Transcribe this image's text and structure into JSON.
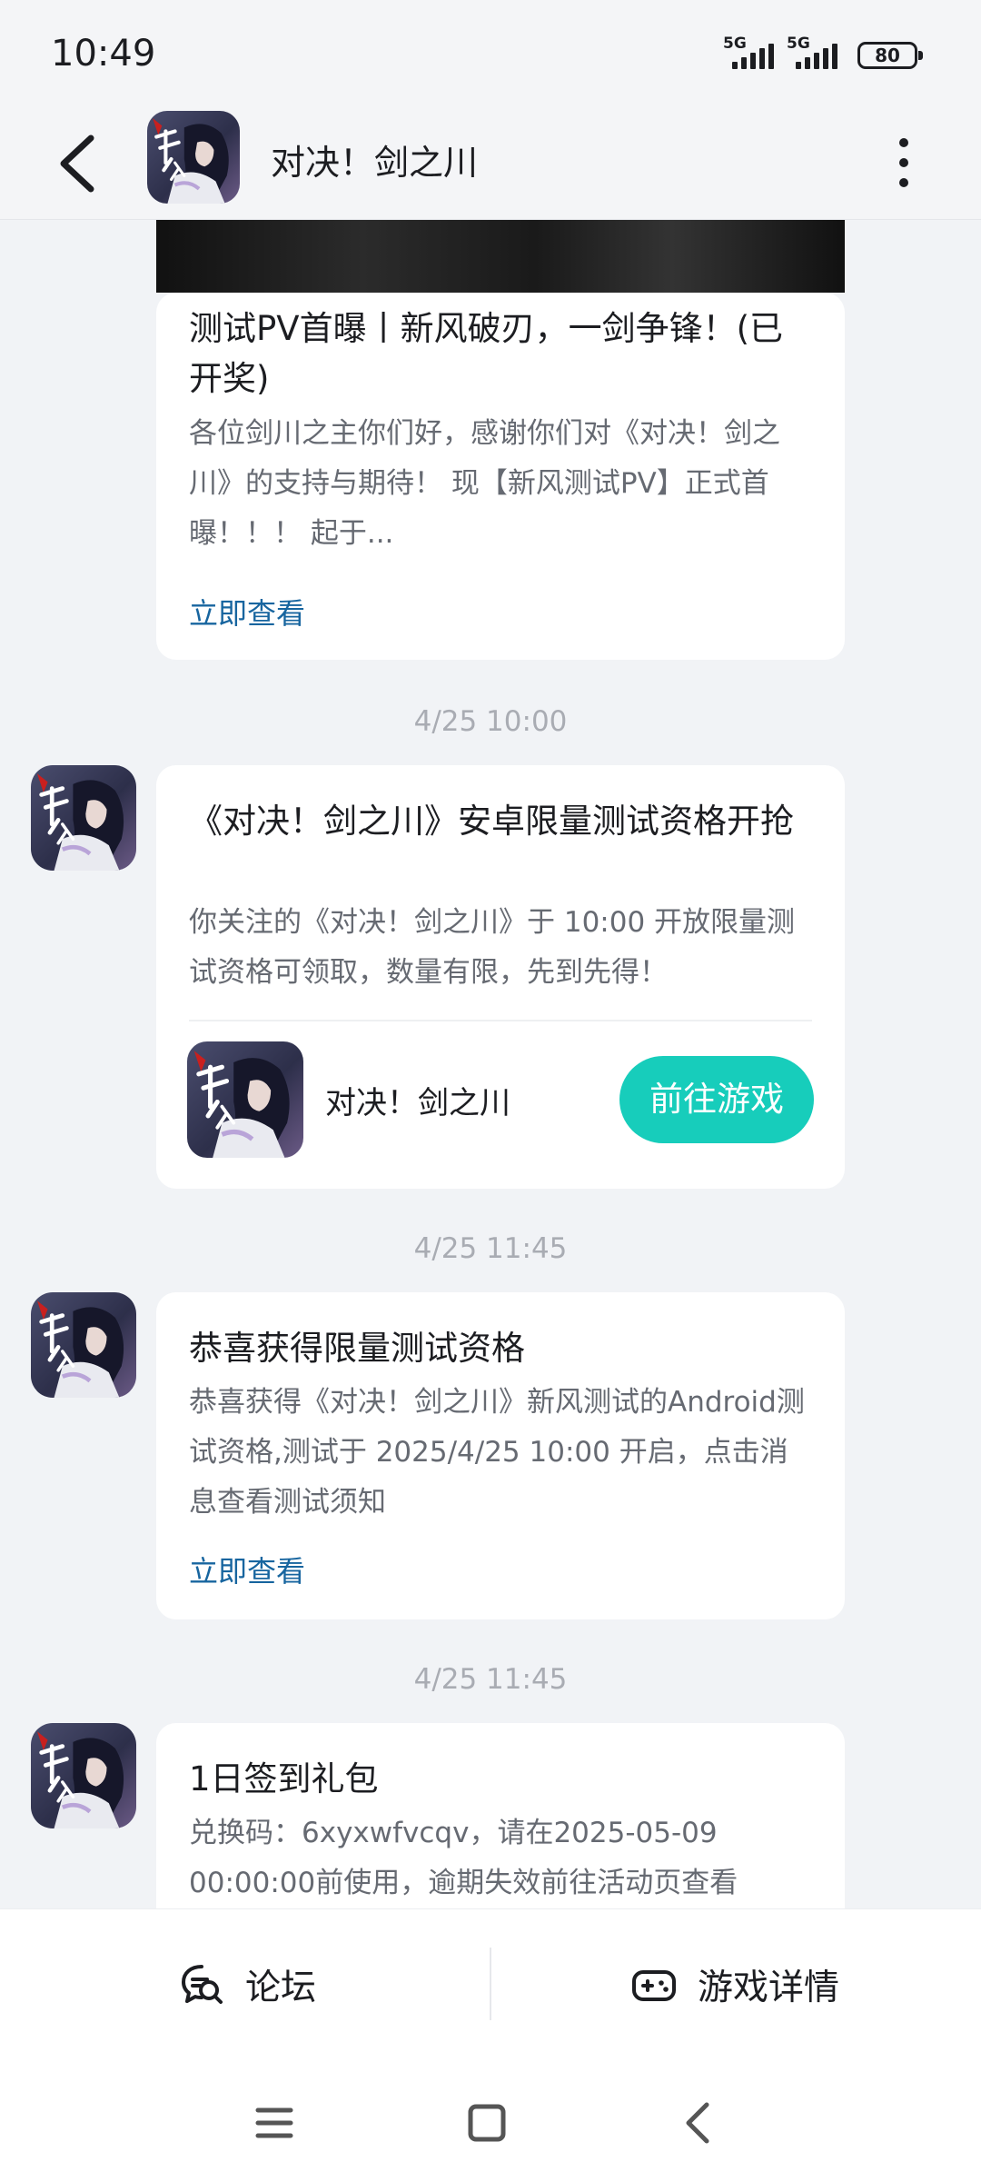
{
  "status_bar": {
    "time": "10:49",
    "signal_1": "5G",
    "signal_2": "5G",
    "battery": "80"
  },
  "header": {
    "title": "对决！剑之川",
    "avatar_icon": "game-logo-icon"
  },
  "messages": [
    {
      "title": "测试PV首曝丨新风破刃，一剑争锋！(已开奖)",
      "body": "各位剑川之主你们好，感谢你们对《对决！剑之川》的支持与期待！ 现【新风测试PV】正式首曝！！！ 起于...",
      "link": "立即查看"
    },
    {
      "timestamp": "4/25  10:00",
      "title": "《对决！剑之川》安卓限量测试资格开抢",
      "body": "你关注的《对决！剑之川》于 10:00 开放限量测试资格可领取，数量有限，先到先得！",
      "game_name": "对决！剑之川",
      "button": "前往游戏"
    },
    {
      "timestamp": "4/25  11:45",
      "title": "恭喜获得限量测试资格",
      "body": "恭喜获得《对决！剑之川》新风测试的Android测试资格,测试于 2025/4/25 10:00 开启，点击消息查看测试须知",
      "link": "立即查看"
    },
    {
      "timestamp": "4/25  11:45",
      "title": "1日签到礼包",
      "body": "兑换码：6xyxwfvcqv，请在2025-05-09 00:00:00前使用，逾期失效前往活动页查看"
    }
  ],
  "action_bar": {
    "forum": "论坛",
    "game_details": "游戏详情"
  },
  "colors": {
    "accent": "#17cdbb",
    "link": "#17659f",
    "background": "#f1f3f6"
  }
}
